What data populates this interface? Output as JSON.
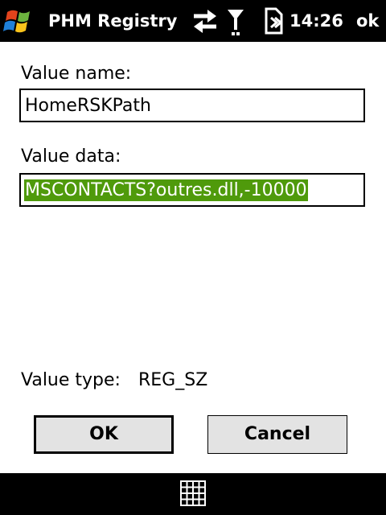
{
  "titlebar": {
    "app_title": "PHM Registry Ed",
    "clock": "14:26",
    "ok_label": "ok",
    "start_icon": "windows-flag-icon",
    "sync_icon": "sync-arrows-icon",
    "signal_icon": "signal-antenna-icon",
    "battery_icon": "battery-icon"
  },
  "form": {
    "name_label": "Value name:",
    "name_value": "HomeRSKPath",
    "data_label": "Value data:",
    "data_value": "MSCONTACTS?outres.dll,-10000",
    "type_label": "Value type:",
    "type_value": "REG_SZ"
  },
  "buttons": {
    "ok_label": "OK",
    "cancel_label": "Cancel"
  },
  "bottombar": {
    "keyboard_icon": "keyboard-icon"
  },
  "colors": {
    "bar_background": "#000000",
    "selection_highlight": "#4f9a0b",
    "button_face": "#e3e3e3"
  }
}
